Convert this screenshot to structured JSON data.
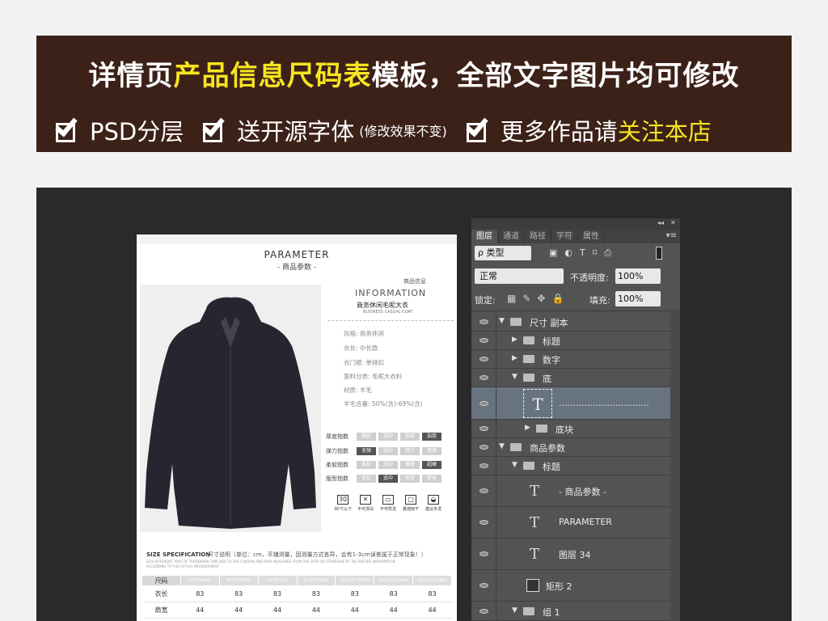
{
  "banner": {
    "title_a": "详情页",
    "title_b": "产品信息尺码表",
    "title_c": "模板，全部文字图片均可修改",
    "feature1": "PSD分层",
    "feature2": "送开源字体",
    "feature2_note": "(修改效果不变)",
    "feature3_a": "更多作品请",
    "feature3_b": "关注本店"
  },
  "document": {
    "title": "PARAMETER",
    "subtitle": "- 商品参数 -",
    "info_small": "商品信息",
    "info_title": "INFORMATION",
    "info_name": "商务休闲毛呢大衣",
    "info_en": "BUSINESS CASUAL COAT",
    "specs": [
      "风格: 商务休闲",
      "衣长: 中长款",
      "衣门襟: 单排扣",
      "面料分类: 毛呢大衣料",
      "材质: 羊毛",
      "羊毛含量: 50%(含)-69%(含)"
    ],
    "indices": [
      {
        "label": "厚度指数",
        "options": [
          "薄款",
          "适中",
          "厚款",
          "加厚"
        ],
        "active": 3
      },
      {
        "label": "弹力指数",
        "options": [
          "无弹",
          "适中",
          "弹力",
          "很弹"
        ],
        "active": 0
      },
      {
        "label": "柔软指数",
        "options": [
          "柔软",
          "适中",
          "偏硬",
          "超硬"
        ],
        "active": 3
      },
      {
        "label": "版型指数",
        "options": [
          "宽松",
          "适中",
          "修身",
          "修身"
        ],
        "active": 1
      }
    ],
    "care": [
      {
        "symbol": "30",
        "label": "30℃以下"
      },
      {
        "symbol": "✕",
        "label": "不可漂白"
      },
      {
        "symbol": "▭",
        "label": "不可熨烫"
      },
      {
        "symbol": "□",
        "label": "悬挂晾干"
      },
      {
        "symbol": "◒",
        "label": "建议手洗"
      }
    ],
    "size_title": "SIZE SPECIFICATION",
    "size_note": "尺寸说明（单位：cm，平铺测量，因测量方式各异，会有1-3cm误差属于正常现象！）",
    "size_note_en1": "SIZE DIFFERENT, PART OF TRADEMARK TIME DOE TO THE CONTAIN AND DATA MEASURED FROM THE DATA OR OTHERSIDE OF THE NATURE INFORMATION",
    "size_note_en2": "ACCORDING TO THE ACTUAL MEASUREMENT",
    "size_header": [
      "尺码",
      "S(168/84A)",
      "M(170/88A)",
      "L(175/92A)",
      "XL(180/96A)",
      "2XL(185/100A)",
      "3XL(190/104A)",
      "4XL(195/108A)"
    ],
    "size_rows": [
      [
        "衣长",
        "83",
        "83",
        "83",
        "83",
        "83",
        "83",
        "83"
      ],
      [
        "肩宽",
        "44",
        "44",
        "44",
        "44",
        "44",
        "44",
        "44"
      ]
    ]
  },
  "panel": {
    "collapse_glyph": "◂◂",
    "close_glyph": "✕",
    "tabs": [
      "图层",
      "通道",
      "路径",
      "字符",
      "属性"
    ],
    "menu_glyph": "▾≡",
    "filter": "ρ 类型",
    "filter_icons": "▣◐T⌑⎙",
    "blend": "正常",
    "opacity_label": "不透明度:",
    "opacity": "100%",
    "lock_label": "锁定:",
    "lock_icons": "▦✎✥🔒",
    "fill_label": "填充:",
    "fill": "100%",
    "layers": [
      {
        "name": "尺寸 副本",
        "type": "group",
        "open": true
      },
      {
        "name": "标题",
        "type": "group",
        "open": false
      },
      {
        "name": "数字",
        "type": "group",
        "open": false
      },
      {
        "name": "底",
        "type": "group",
        "open": true
      },
      {
        "name": "................................",
        "type": "text",
        "selected": true
      },
      {
        "name": "底块",
        "type": "group",
        "open": false
      },
      {
        "name": "商品参数",
        "type": "group",
        "open": true
      },
      {
        "name": "标题",
        "type": "group",
        "open": true
      },
      {
        "name": "- 商品参数 -",
        "type": "text"
      },
      {
        "name": "PARAMETER",
        "type": "text"
      },
      {
        "name": "图层 34",
        "type": "text"
      },
      {
        "name": "矩形 2",
        "type": "shape"
      },
      {
        "name": "组 1",
        "type": "group",
        "open": true
      }
    ]
  }
}
